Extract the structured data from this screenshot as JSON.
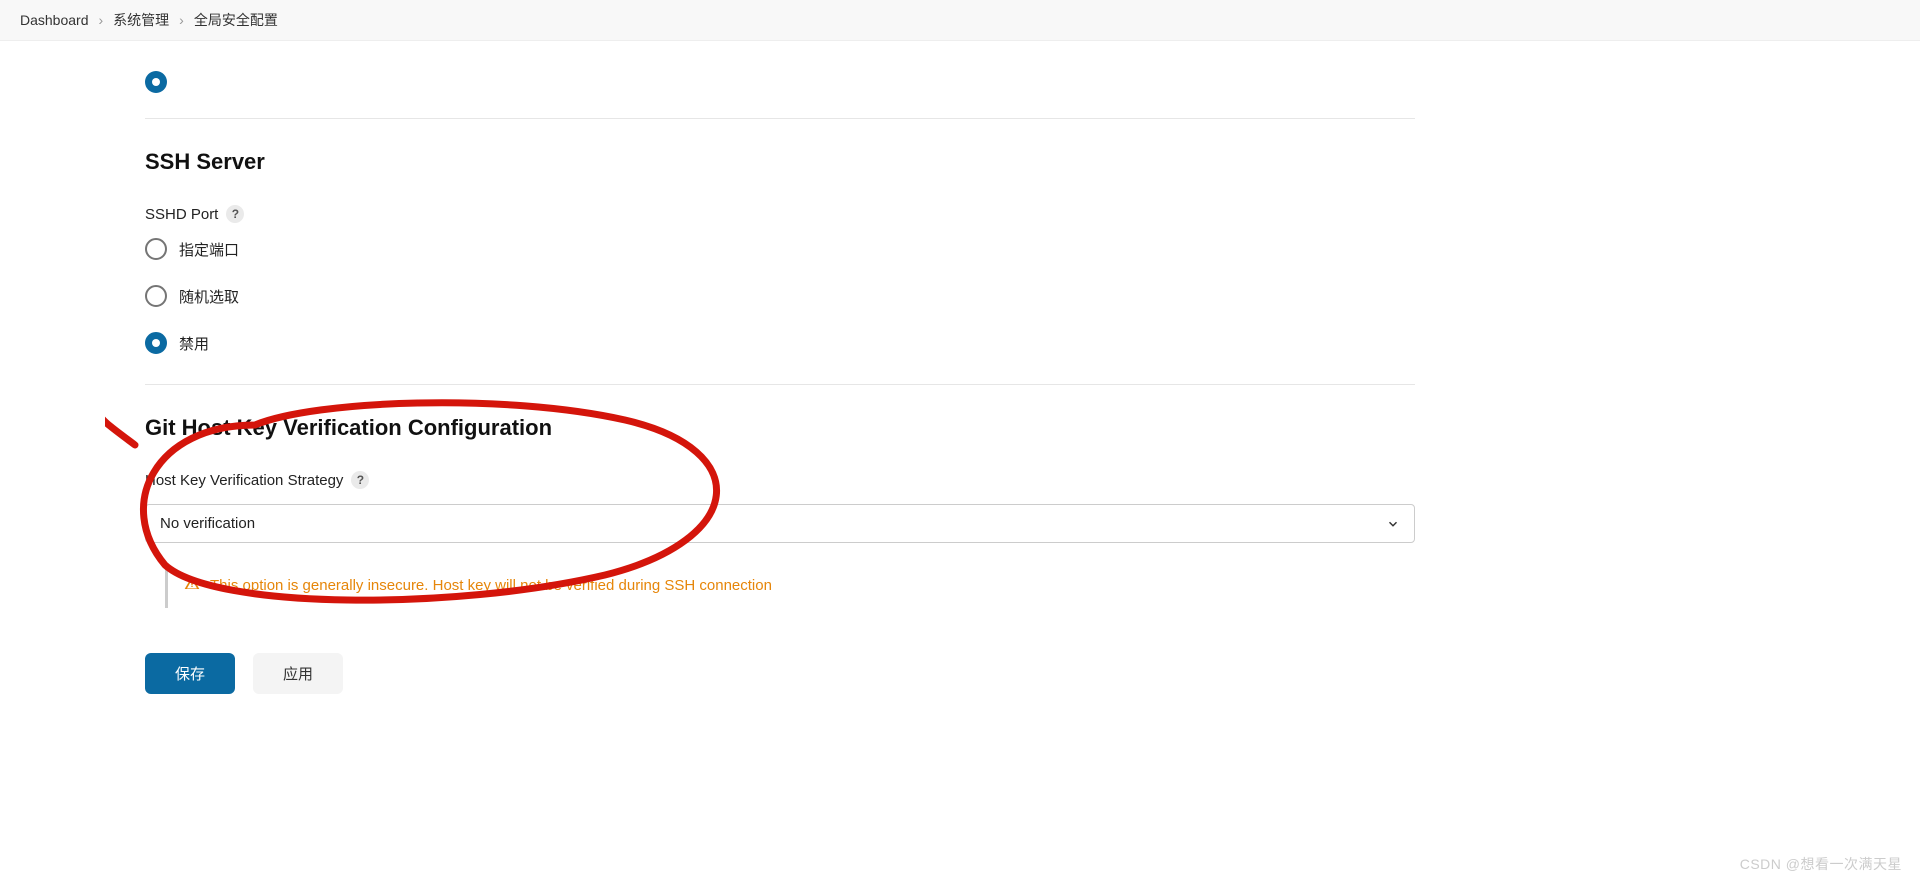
{
  "breadcrumb": {
    "items": [
      "Dashboard",
      "系统管理",
      "全局安全配置"
    ]
  },
  "sections": {
    "ssh": {
      "title": "SSH Server",
      "port_label": "SSHD Port",
      "options": [
        {
          "label": "指定端口",
          "selected": false
        },
        {
          "label": "随机选取",
          "selected": false
        },
        {
          "label": "禁用",
          "selected": true
        }
      ]
    },
    "git": {
      "title": "Git Host Key Verification Configuration",
      "strategy_label": "Host Key Verification Strategy",
      "selected_value": "No verification",
      "warning": "This option is generally insecure. Host key will not be verified during SSH connection"
    }
  },
  "buttons": {
    "save": "保存",
    "apply": "应用"
  },
  "help_glyph": "?",
  "watermark": "CSDN @想看一次满天星"
}
